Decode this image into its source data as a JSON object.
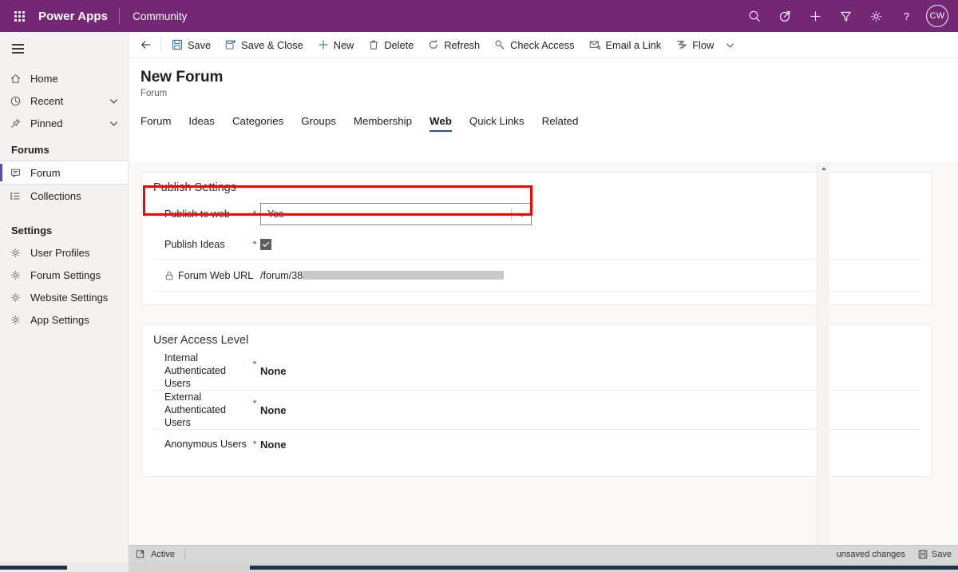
{
  "topbar": {
    "waffle_label": "App launcher",
    "brand": "Power Apps",
    "app_name": "Community",
    "icons": [
      {
        "name": "search-icon",
        "label": "Search"
      },
      {
        "name": "assistant-icon",
        "label": "Relationship assistant"
      },
      {
        "name": "plus-icon",
        "label": "Quick create"
      },
      {
        "name": "filter-icon",
        "label": "Filter"
      },
      {
        "name": "gear-icon",
        "label": "Settings"
      },
      {
        "name": "help-icon",
        "label": "Help"
      }
    ],
    "avatar_initials": "CW"
  },
  "sidebar": {
    "hamburger_label": "Show / hide navigation",
    "items": [
      {
        "label": "Home",
        "icon": "home-icon",
        "chevron": false,
        "selected": false
      },
      {
        "label": "Recent",
        "icon": "clock-icon",
        "chevron": true,
        "selected": false
      },
      {
        "label": "Pinned",
        "icon": "pin-icon",
        "chevron": true,
        "selected": false
      }
    ],
    "groups": [
      {
        "title": "Forums",
        "items": [
          {
            "label": "Forum",
            "icon": "forum-icon",
            "selected": true
          },
          {
            "label": "Collections",
            "icon": "collections-icon",
            "selected": false
          }
        ]
      },
      {
        "title": "Settings",
        "items": [
          {
            "label": "User Profiles",
            "icon": "gear-icon",
            "selected": false
          },
          {
            "label": "Forum Settings",
            "icon": "gear-icon",
            "selected": false
          },
          {
            "label": "Website Settings",
            "icon": "gear-icon",
            "selected": false
          },
          {
            "label": "App Settings",
            "icon": "gear-icon",
            "selected": false
          }
        ]
      }
    ]
  },
  "commandbar": {
    "back_label": "Back",
    "buttons": [
      {
        "label": "Save",
        "icon": "save-icon"
      },
      {
        "label": "Save & Close",
        "icon": "save-close-icon"
      },
      {
        "label": "New",
        "icon": "plus-icon"
      },
      {
        "label": "Delete",
        "icon": "trash-icon"
      },
      {
        "label": "Refresh",
        "icon": "refresh-icon"
      },
      {
        "label": "Check Access",
        "icon": "key-icon"
      },
      {
        "label": "Email a Link",
        "icon": "email-icon"
      },
      {
        "label": "Flow",
        "icon": "flow-icon"
      }
    ],
    "overflow_label": "More commands"
  },
  "header": {
    "title": "New Forum",
    "subtitle": "Forum"
  },
  "tabs": [
    {
      "label": "Forum",
      "active": false
    },
    {
      "label": "Ideas",
      "active": false
    },
    {
      "label": "Categories",
      "active": false
    },
    {
      "label": "Groups",
      "active": false
    },
    {
      "label": "Membership",
      "active": false
    },
    {
      "label": "Web",
      "active": true
    },
    {
      "label": "Quick Links",
      "active": false
    },
    {
      "label": "Related",
      "active": false
    }
  ],
  "publish_settings": {
    "section_title": "Publish Settings",
    "publish_to_web": {
      "label": "Publish to web",
      "required": "*",
      "value": "Yes",
      "highlighted": true
    },
    "publish_ideas": {
      "label": "Publish Ideas",
      "required": "*",
      "checked": true,
      "check_glyph": "✓"
    },
    "forum_web_url": {
      "label": "Forum Web URL",
      "icon": "lock-icon",
      "value_visible": "/forum/38",
      "value_redacted": true
    }
  },
  "user_access_level": {
    "section_title": "User Access Level",
    "rows": [
      {
        "label": "Internal Authenticated Users",
        "required": "*",
        "value": "None"
      },
      {
        "label": "External Authenticated Users",
        "required": "*",
        "value": "None"
      },
      {
        "label": "Anonymous Users",
        "required": "*",
        "value": "None"
      }
    ]
  },
  "footer": {
    "expand_label": "Expand",
    "status": "Active",
    "unsaved": "unsaved changes",
    "save_label": "Save"
  },
  "colors": {
    "brand_purple": "#742774",
    "accent_blue": "#1a53c0",
    "selected_bar": "#4f52b2",
    "required_red": "#a4262c",
    "highlight_red": "#ff0000"
  }
}
